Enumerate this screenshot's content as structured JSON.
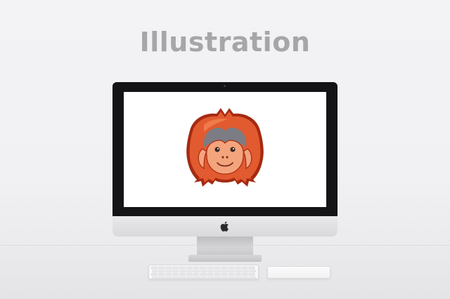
{
  "heading": {
    "text": "Illustration"
  },
  "illustration": {
    "subject": "orangutan-face",
    "colors": {
      "outline": "#a52a12",
      "hair": "#e25a2f",
      "hair_light": "#f07a4a",
      "forehead": "#7c7c84",
      "face": "#f4a47d",
      "eyes": "#3b2a26",
      "mouth": "#7a2e1c"
    }
  },
  "device": {
    "logo_icon": "apple-logo-icon",
    "bezel_color": "#141416",
    "body_color": "#e4e4e6"
  }
}
